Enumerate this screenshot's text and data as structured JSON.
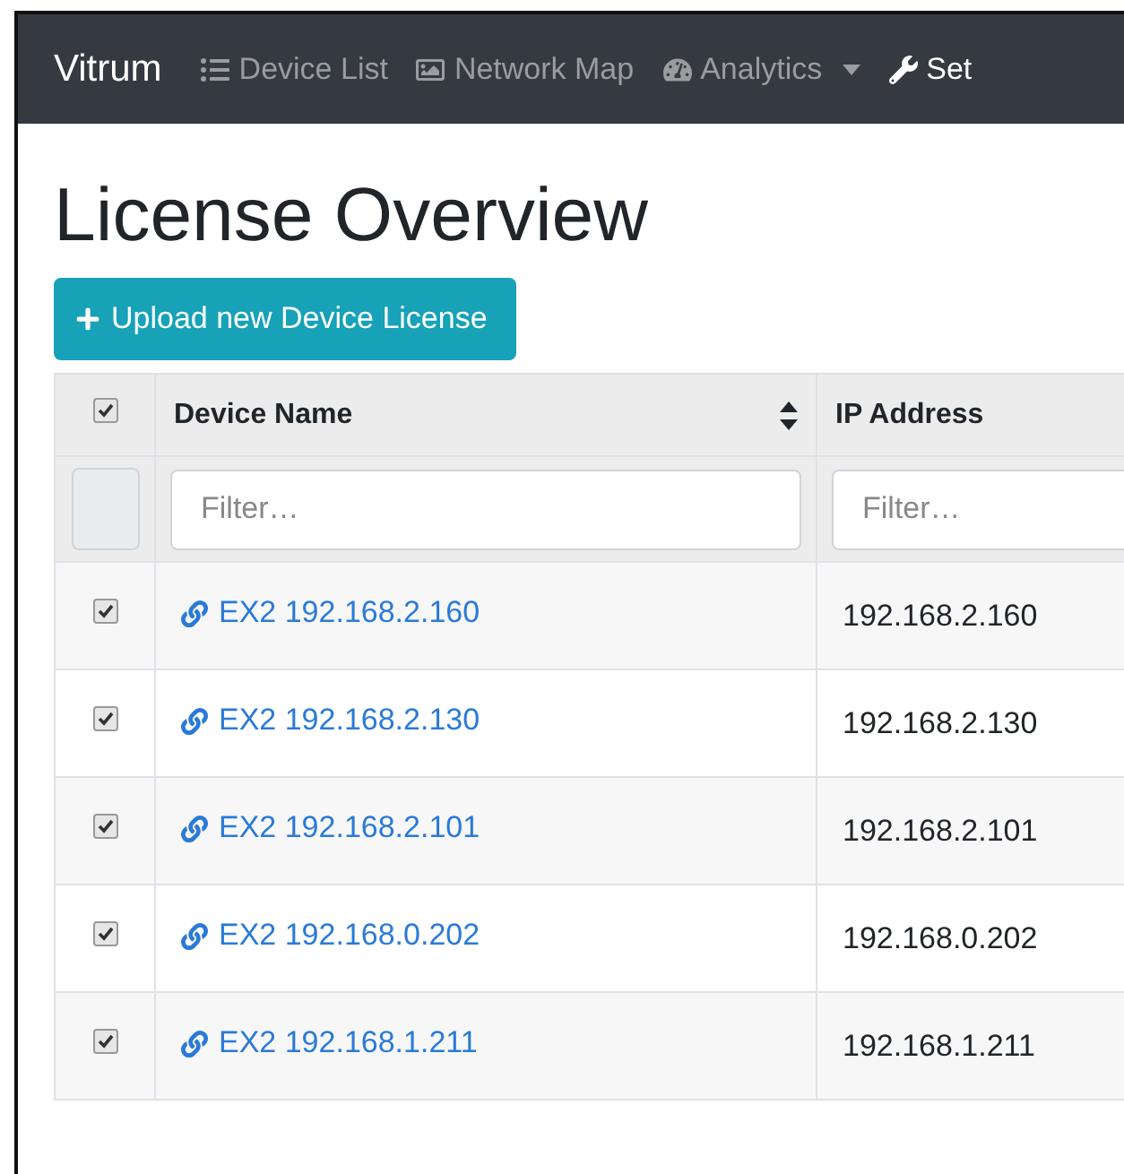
{
  "navbar": {
    "brand": "Vitrum",
    "items": [
      {
        "label": "Device List",
        "selected": false,
        "dropdown": false
      },
      {
        "label": "Network Map",
        "selected": false,
        "dropdown": false
      },
      {
        "label": "Analytics",
        "selected": false,
        "dropdown": true
      },
      {
        "label": "Set",
        "selected": true,
        "dropdown": false
      }
    ]
  },
  "title": "License Overview",
  "upload_button": "Upload new Device License",
  "table": {
    "select_all_checked": true,
    "filter_checked": false,
    "columns": [
      {
        "label": "Device Name",
        "sortable": true
      },
      {
        "label": "IP Address",
        "sortable": false
      }
    ],
    "filters": [
      {
        "placeholder": "Filter…"
      },
      {
        "placeholder": "Filter…"
      }
    ],
    "rows": [
      {
        "checked": true,
        "device": "EX2 192.168.2.160",
        "ip": "192.168.2.160"
      },
      {
        "checked": true,
        "device": "EX2 192.168.2.130",
        "ip": "192.168.2.130"
      },
      {
        "checked": true,
        "device": "EX2 192.168.2.101",
        "ip": "192.168.2.101"
      },
      {
        "checked": true,
        "device": "EX2 192.168.0.202",
        "ip": "192.168.0.202"
      },
      {
        "checked": true,
        "device": "EX2 192.168.1.211",
        "ip": "192.168.1.211"
      }
    ]
  }
}
